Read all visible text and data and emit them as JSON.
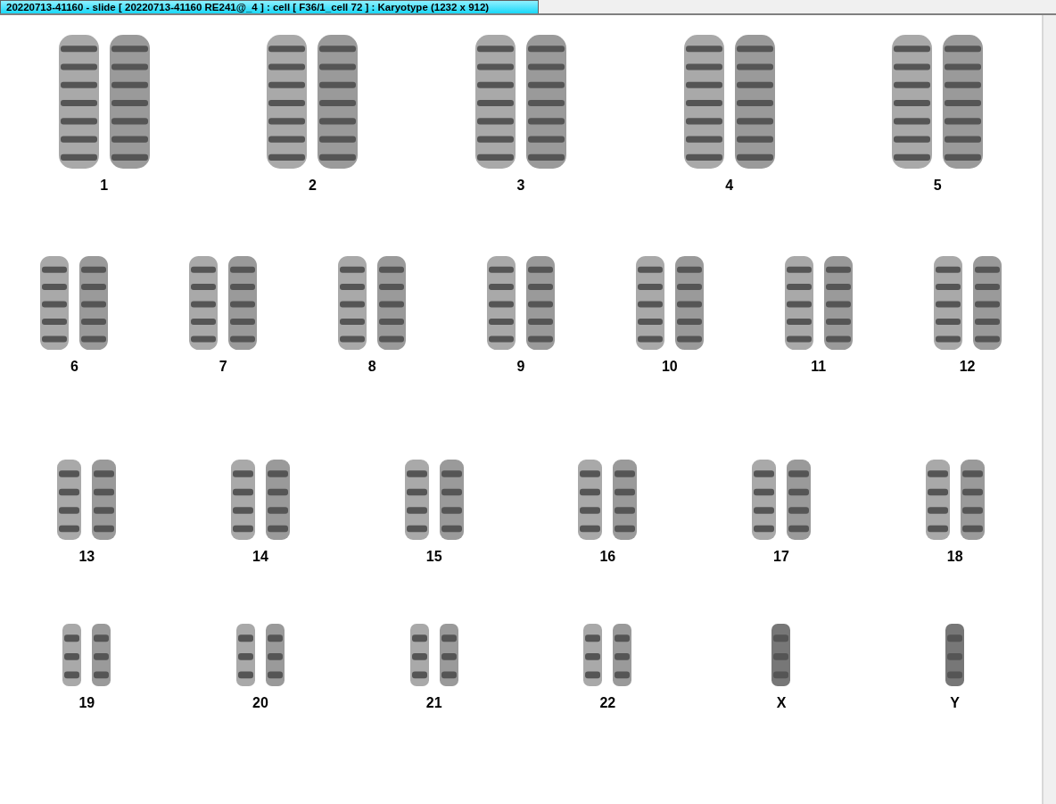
{
  "window": {
    "title": "20220713-41160 - slide [ 20220713-41160 RE241@_4 ] : cell [ F36/1_cell 72 ] : Karyotype  (1232 x 912)"
  },
  "karyotype": {
    "rows": [
      {
        "items": [
          {
            "label": "1",
            "kind": "pair"
          },
          {
            "label": "2",
            "kind": "pair"
          },
          {
            "label": "3",
            "kind": "pair"
          },
          {
            "label": "4",
            "kind": "pair"
          },
          {
            "label": "5",
            "kind": "pair"
          }
        ]
      },
      {
        "items": [
          {
            "label": "6",
            "kind": "pair"
          },
          {
            "label": "7",
            "kind": "pair"
          },
          {
            "label": "8",
            "kind": "pair"
          },
          {
            "label": "9",
            "kind": "pair"
          },
          {
            "label": "10",
            "kind": "pair"
          },
          {
            "label": "11",
            "kind": "pair"
          },
          {
            "label": "12",
            "kind": "pair"
          }
        ]
      },
      {
        "items": [
          {
            "label": "13",
            "kind": "pair"
          },
          {
            "label": "14",
            "kind": "pair"
          },
          {
            "label": "15",
            "kind": "pair"
          },
          {
            "label": "16",
            "kind": "pair"
          },
          {
            "label": "17",
            "kind": "pair"
          },
          {
            "label": "18",
            "kind": "pair"
          }
        ]
      },
      {
        "items": [
          {
            "label": "19",
            "kind": "pair"
          },
          {
            "label": "20",
            "kind": "pair"
          },
          {
            "label": "21",
            "kind": "pair"
          },
          {
            "label": "22",
            "kind": "pair"
          },
          {
            "label": "X",
            "kind": "single"
          },
          {
            "label": "Y",
            "kind": "single"
          }
        ]
      }
    ]
  }
}
